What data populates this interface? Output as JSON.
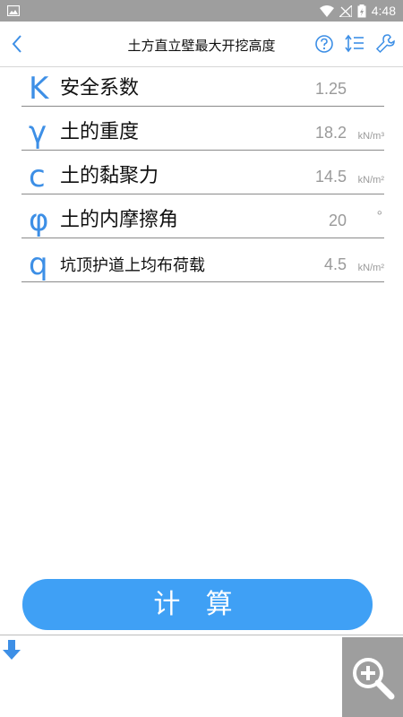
{
  "status_bar": {
    "time": "4:48"
  },
  "header": {
    "title": "土方直立壁最大开挖高度"
  },
  "params": [
    {
      "symbol": "K",
      "label": "安全系数",
      "value": "1.25",
      "unit": ""
    },
    {
      "symbol": "γ",
      "label": "土的重度",
      "value": "18.2",
      "unit": "kN/m³"
    },
    {
      "symbol": "c",
      "label": "土的黏聚力",
      "value": "14.5",
      "unit": "kN/m²"
    },
    {
      "symbol": "φ",
      "label": "土的内摩擦角",
      "value": "20",
      "unit": "°"
    },
    {
      "symbol": "q",
      "label": "坑顶护道上均布荷载",
      "value": "4.5",
      "unit": "kN/m²"
    }
  ],
  "actions": {
    "calculate_label": "计 算"
  },
  "colors": {
    "accent": "#3fa0f5",
    "symbol": "#3d8fe6",
    "statusbar": "#9e9e9e"
  }
}
